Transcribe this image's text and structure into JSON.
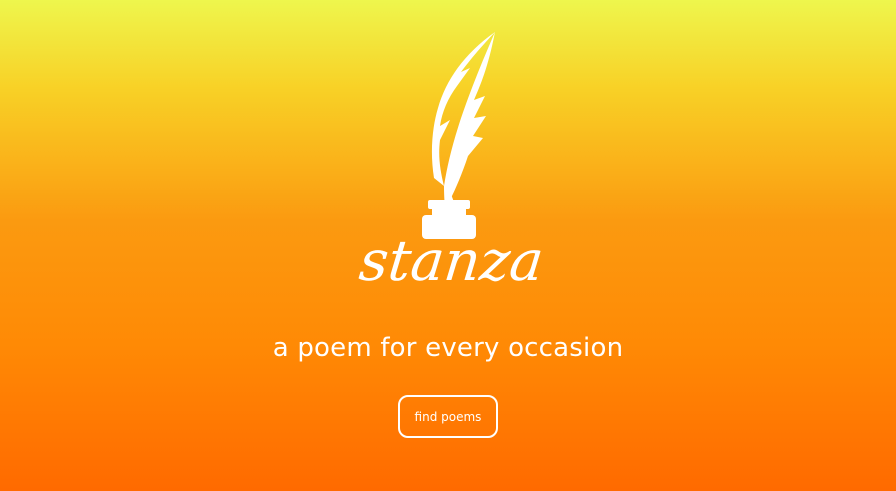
{
  "brand": {
    "name": "stanza",
    "logo_icon": "quill-inkwell-icon"
  },
  "hero": {
    "tagline": "a poem for every occasion",
    "cta_label": "find poems"
  },
  "colors": {
    "gradient_top": "#eef64d",
    "gradient_mid": "#fb9a10",
    "gradient_bottom": "#ff6a00",
    "foreground": "#ffffff"
  }
}
